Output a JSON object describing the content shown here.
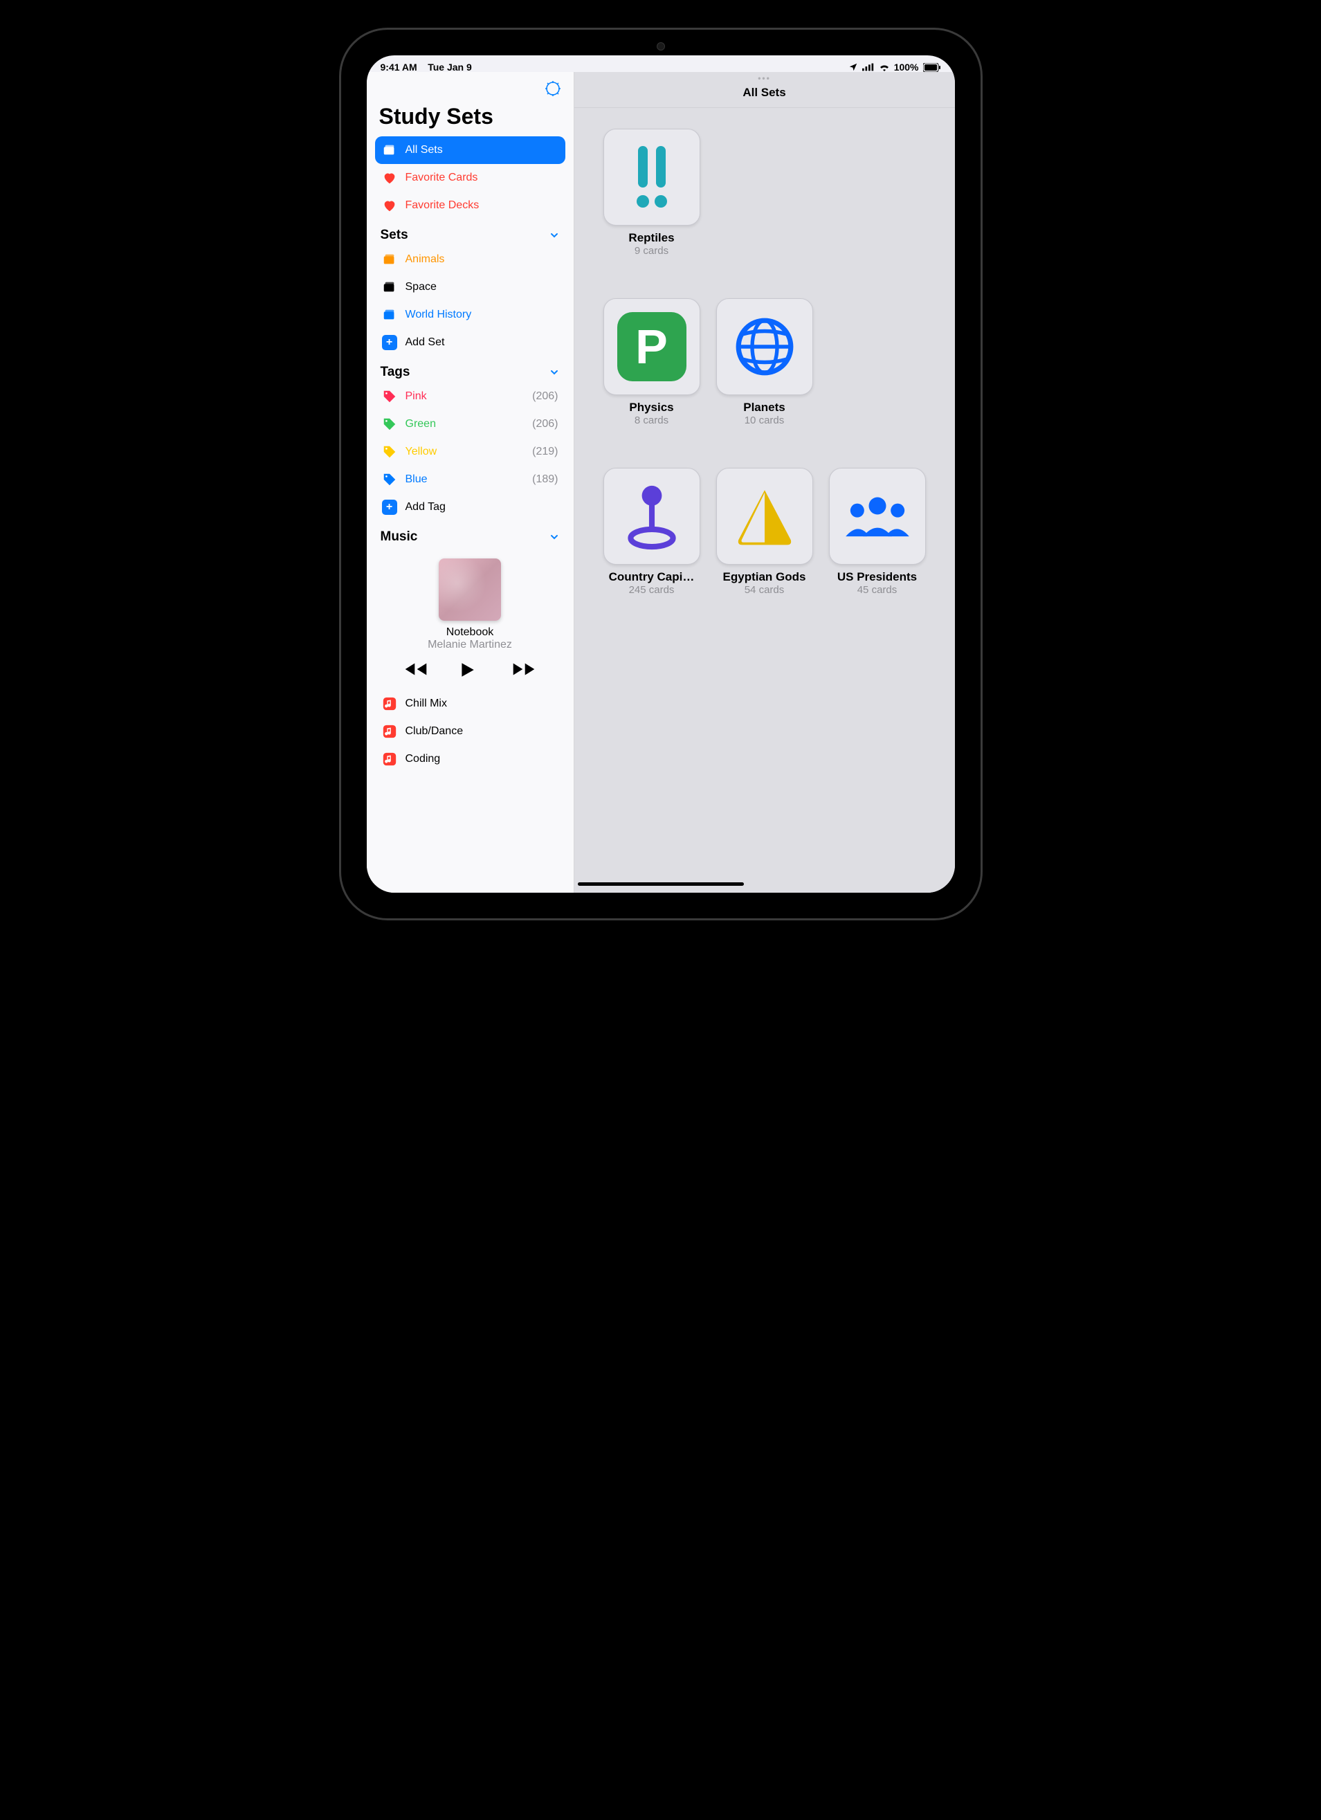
{
  "statusbar": {
    "time": "9:41 AM",
    "date": "Tue Jan 9",
    "battery": "100%"
  },
  "sidebar": {
    "title": "Study Sets",
    "all_sets": "All Sets",
    "fav_cards": "Favorite Cards",
    "fav_decks": "Favorite Decks",
    "sets_header": "Sets",
    "sets": [
      {
        "label": "Animals",
        "color": "orange"
      },
      {
        "label": "Space",
        "color": "black"
      },
      {
        "label": "World History",
        "color": "blue"
      }
    ],
    "add_set": "Add Set",
    "tags_header": "Tags",
    "tags": [
      {
        "label": "Pink",
        "color": "pink",
        "count": "(206)"
      },
      {
        "label": "Green",
        "color": "green",
        "count": "(206)"
      },
      {
        "label": "Yellow",
        "color": "yellow",
        "count": "(219)"
      },
      {
        "label": "Blue",
        "color": "blue",
        "count": "(189)"
      }
    ],
    "add_tag": "Add Tag",
    "music_header": "Music",
    "music": {
      "track": "Notebook",
      "artist": "Melanie Martinez"
    },
    "playlists": [
      {
        "label": "Chill Mix"
      },
      {
        "label": "Club/Dance"
      },
      {
        "label": "Coding"
      }
    ]
  },
  "main": {
    "title": "All Sets",
    "cards": [
      {
        "title": "Reptiles",
        "count": "9 cards",
        "icon": "exclaim",
        "fg": "#1fa8b8",
        "bg": "transparent"
      },
      {
        "title": "",
        "count": "",
        "icon": "",
        "fg": "",
        "bg": ""
      },
      {
        "title": "",
        "count": "",
        "icon": "",
        "fg": "",
        "bg": ""
      },
      {
        "title": "Physics",
        "count": "8 cards",
        "icon": "letter-p",
        "fg": "#ffffff",
        "bg": "#2ea44f"
      },
      {
        "title": "Planets",
        "count": "10 cards",
        "icon": "globe",
        "fg": "#0a66ff",
        "bg": "transparent"
      },
      {
        "title": "",
        "count": "",
        "icon": "",
        "fg": "",
        "bg": ""
      },
      {
        "title": "Country Capi…",
        "count": "245 cards",
        "icon": "pin",
        "fg": "#5b3fd9",
        "bg": "transparent"
      },
      {
        "title": "Egyptian Gods",
        "count": "54 cards",
        "icon": "triangle",
        "fg": "#e6b800",
        "bg": "transparent"
      },
      {
        "title": "US Presidents",
        "count": "45 cards",
        "icon": "people",
        "fg": "#0a66ff",
        "bg": "transparent"
      }
    ]
  }
}
